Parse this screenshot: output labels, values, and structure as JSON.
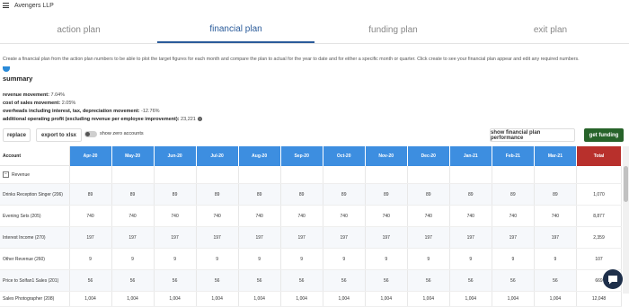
{
  "app": {
    "title": "Avengers LLP"
  },
  "tabs": [
    {
      "label": "action plan",
      "active": false
    },
    {
      "label": "financial plan",
      "active": true
    },
    {
      "label": "funding plan",
      "active": false
    },
    {
      "label": "exit plan",
      "active": false
    }
  ],
  "intro_text": "Create a financial plan from the action plan numbers to be able to plot the target figures for each month and compare the plan to actual for the year to date and for either a specific month or quarter. Click create to see your financial plan appear and edit any required numbers.",
  "summary": {
    "title": "summary",
    "metrics": [
      {
        "label": "revenue movement:",
        "value": "7.04%"
      },
      {
        "label": "cost of sales movement:",
        "value": "2.05%"
      },
      {
        "label": "overheads including interest, tax, depreciation movement:",
        "value": "-12.76%"
      },
      {
        "label": "additional operating profit (excluding revenue per employee improvement):",
        "value": "23,221"
      }
    ]
  },
  "toolbar": {
    "replace": "replace",
    "export": "export to xlsx",
    "toggle_label": "show zero accounts",
    "show_performance": "show financial plan performance",
    "get_funding": "get funding"
  },
  "table": {
    "account_header": "Account",
    "months": [
      "Apr-20",
      "May-20",
      "Jun-20",
      "Jul-20",
      "Aug-20",
      "Sep-20",
      "Oct-20",
      "Nov-20",
      "Dec-20",
      "Jan-21",
      "Feb-21",
      "Mar-21"
    ],
    "total_header": "Total",
    "group_label": "Revenue",
    "rows": [
      {
        "name": "Drinks Reception Singer (206)",
        "values": [
          "89",
          "89",
          "89",
          "89",
          "89",
          "89",
          "89",
          "89",
          "89",
          "89",
          "89",
          "89"
        ],
        "total": "1,070"
      },
      {
        "name": "Evening Sets (205)",
        "values": [
          "740",
          "740",
          "740",
          "740",
          "740",
          "740",
          "740",
          "740",
          "740",
          "740",
          "740",
          "740"
        ],
        "total": "8,877"
      },
      {
        "name": "Interest Income (270)",
        "values": [
          "197",
          "197",
          "197",
          "197",
          "197",
          "197",
          "197",
          "197",
          "197",
          "197",
          "197",
          "197"
        ],
        "total": "2,359"
      },
      {
        "name": "Other Revenue (260)",
        "values": [
          "9",
          "9",
          "9",
          "9",
          "9",
          "9",
          "9",
          "9",
          "9",
          "9",
          "9",
          "9"
        ],
        "total": "107"
      },
      {
        "name": "Price to Solfan1 Sales (201)",
        "values": [
          "56",
          "56",
          "56",
          "56",
          "56",
          "56",
          "56",
          "56",
          "56",
          "56",
          "56",
          "56"
        ],
        "total": "669"
      },
      {
        "name": "Sales Photographer (208)",
        "values": [
          "1,004",
          "1,004",
          "1,004",
          "1,004",
          "1,004",
          "1,004",
          "1,004",
          "1,004",
          "1,004",
          "1,004",
          "1,004",
          "1,004"
        ],
        "total": "12,048"
      }
    ]
  },
  "colors": {
    "accent": "#3d8ee0",
    "total": "#b8302c",
    "green": "#27632a",
    "active_tab": "#2a5b9a"
  }
}
